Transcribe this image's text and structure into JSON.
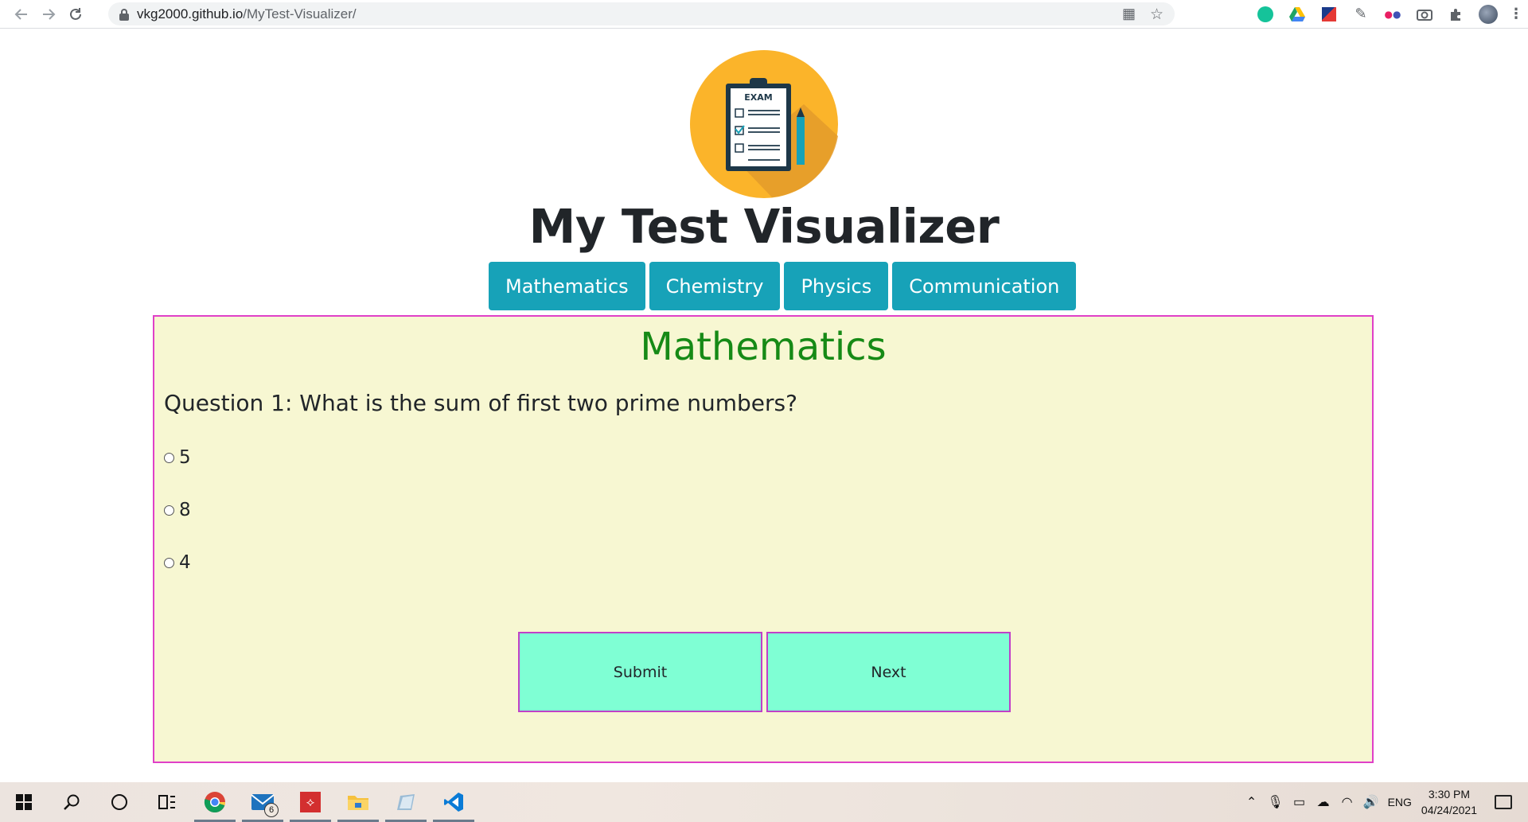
{
  "browser": {
    "url_host": "vkg2000.github.io",
    "url_path": "/MyTest-Visualizer/"
  },
  "page": {
    "logo_text": "EXAM",
    "title": "My Test Visualizer",
    "subjects": [
      "Mathematics",
      "Chemistry",
      "Physics",
      "Communication"
    ]
  },
  "quiz": {
    "subject": "Mathematics",
    "question": "Question 1: What is the sum of first two prime numbers?",
    "options": [
      "5",
      "8",
      "4"
    ],
    "submit_label": "Submit",
    "next_label": "Next"
  },
  "colors": {
    "subject_tab": "#17a2b8",
    "quiz_background": "#f7f7d2",
    "quiz_border": "#e040c8",
    "heading": "#168a16",
    "action_button": "#7fffd4"
  },
  "taskbar": {
    "mail_badge": "6",
    "language": "ENG",
    "time": "3:30 PM",
    "date": "04/24/2021"
  }
}
